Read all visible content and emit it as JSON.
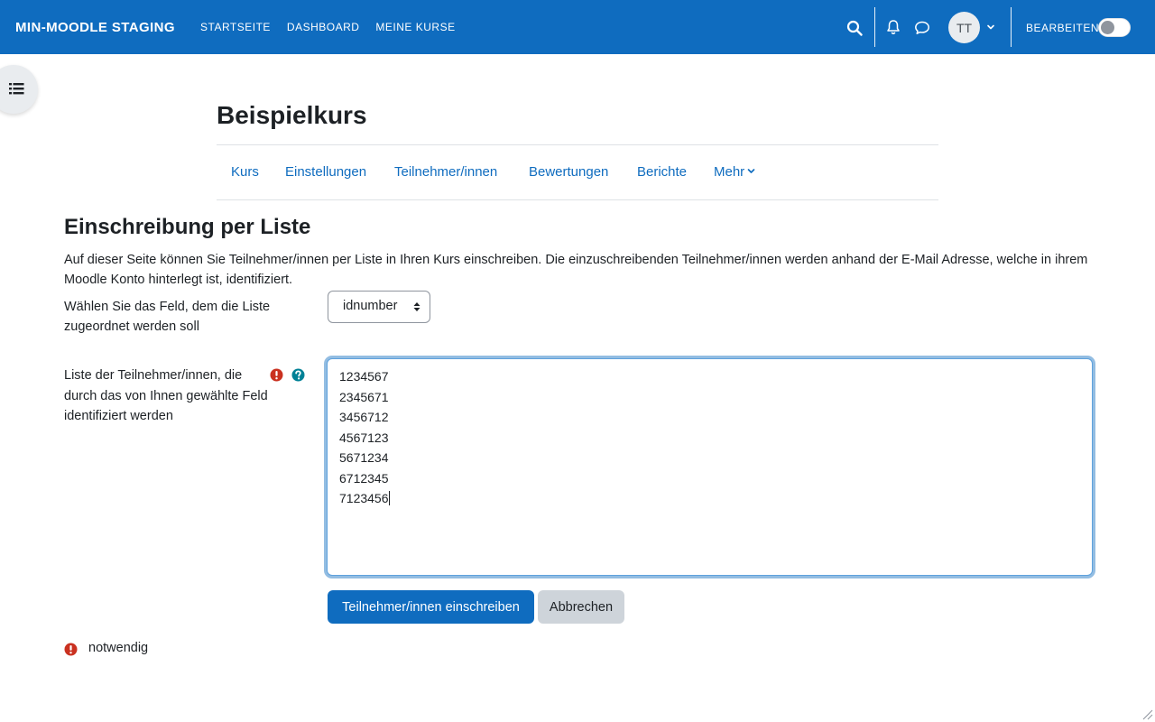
{
  "navbar": {
    "brand": "MIN-MOODLE STAGING",
    "items": [
      "STARTSEITE",
      "DASHBOARD",
      "MEINE KURSE"
    ],
    "avatar_initials": "TT",
    "edit_label": "BEARBEITEN",
    "edit_mode_on": false,
    "color": "#0f6cbf"
  },
  "course": {
    "title": "Beispielkurs",
    "tabs": [
      "Kurs",
      "Einstellungen",
      "Teilnehmer/innen",
      "Bewertungen",
      "Berichte",
      "Mehr"
    ]
  },
  "main": {
    "heading": "Einschreibung per Liste",
    "intro": "Auf dieser Seite können Sie Teilnehmer/innen per Liste in Ihren Kurs einschreiben. Die einzuschreibenden Teilnehmer/innen werden anhand der E-Mail Adresse, welche in ihrem Moodle Konto hinterlegt ist, identifiziert.",
    "field_select_label": "Wählen Sie das Feld, dem die Liste zugeordnet werden soll",
    "field_select_value": "idnumber",
    "list_label": "Liste der Teilnehmer/innen, die durch das von Ihnen gewählte Feld identifiziert werden",
    "list_values": [
      "1234567",
      "2345671",
      "3456712",
      "4567123",
      "5671234",
      "6712345",
      "7123456"
    ],
    "submit_label": "Teilnehmer/innen einschreiben",
    "cancel_label": "Abbrechen",
    "required_note": "notwendig"
  },
  "icons": {
    "search": "search-icon",
    "notifications": "bell-icon",
    "messages": "chat-icon",
    "drawer": "list-icon",
    "required": "exclamation-circle-icon",
    "help": "question-circle-icon"
  },
  "colors": {
    "primary": "#0f6cbf",
    "required": "#ca3120",
    "help": "#008196"
  }
}
